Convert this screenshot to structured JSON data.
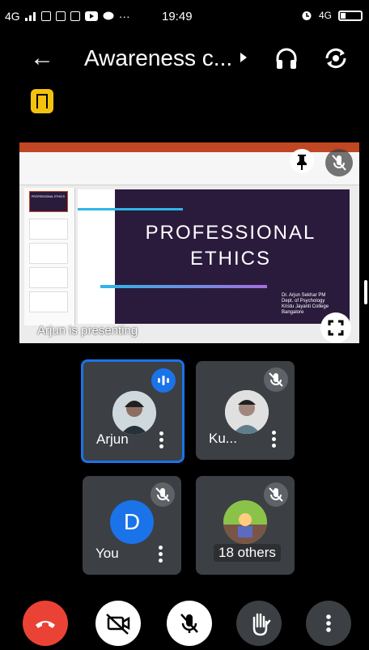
{
  "status_bar": {
    "network": "4G",
    "time": "19:49",
    "right_network": "4G"
  },
  "header": {
    "title": "Awareness c...",
    "icons": [
      "back-arrow-icon",
      "chevron-right-icon",
      "headphones-icon",
      "switch-camera-icon"
    ]
  },
  "presentation": {
    "slide_title_line1": "PROFESSIONAL",
    "slide_title_line2": "ETHICS",
    "slide_author": "Dr. Arjun Sekhar PM\nDept. of Psychology\nKristu Jayanti College\nBangalore",
    "thumb_label": "PROFESSIONAL ETHICS",
    "presenting_text": "Arjun is presenting"
  },
  "participants": [
    {
      "name": "Arjun",
      "speaking": true
    },
    {
      "name": "Ku...",
      "muted": true
    },
    {
      "name": "You",
      "initial": "D",
      "muted": true
    },
    {
      "name": "18 others",
      "muted": true
    }
  ],
  "controls": [
    "end-call",
    "camera-off",
    "mic-off",
    "raise-hand",
    "more-options"
  ],
  "colors": {
    "end_call": "#ea4335",
    "accent_blue": "#1a73e8",
    "tile_bg": "#3c3f43",
    "lock_badge": "#f4c20d",
    "slide_bg": "#2a1b3d"
  }
}
